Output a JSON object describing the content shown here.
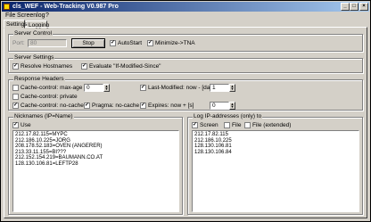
{
  "window": {
    "title": "cls_WEF - Web-Tracking V0.987 Pro",
    "min": "_",
    "max": "□",
    "close": "×"
  },
  "menu": [
    "File",
    "Screenlog",
    "?"
  ],
  "tabs": [
    "Settings",
    "Logging"
  ],
  "server_control": {
    "title": "Server Control",
    "port_label": "Port:",
    "port_value": "80",
    "stop_label": "Stop",
    "autostart_label": "AutoStart",
    "autostart_checked": true,
    "minimize_label": "Minimize->TNA",
    "minimize_checked": true
  },
  "server_settings": {
    "title": "Server Settings",
    "resolve_label": "Resolve Hostnames",
    "resolve_checked": true,
    "evaluate_label": "Evaluate \"If-Modified-Since\"",
    "evaluate_checked": true
  },
  "response_headers": {
    "title": "Response Headers",
    "maxage_label": "Cache-control: max-age [s]",
    "maxage_checked": false,
    "maxage_value": "0",
    "private_label": "Cache-control: private",
    "private_checked": false,
    "nocache_label": "Cache-control: no-cache",
    "nocache_checked": true,
    "pragma_label": "Pragma: no-cache",
    "pragma_checked": true,
    "lastmod_label": "Last-Modified: now - [days]",
    "lastmod_checked": true,
    "lastmod_value": "1",
    "expires_label": "Expires: now + [s]",
    "expires_checked": true,
    "expires_value": "0"
  },
  "nicknames": {
    "title": "Nicknames (IP=Name)",
    "use_label": "Use",
    "use_checked": true,
    "lines": [
      "212.17.82.115=MYPC",
      "212.186.10.225=JORG",
      "208.178.52.183=OVEN (ANGERER)",
      "213.33.11.155=BI???",
      "212.152.154.219=BAUMANN.CO.AT",
      "128.130.106.81=LEFTP28"
    ]
  },
  "log_ip": {
    "title": "Log IP-addresses (only) to",
    "screen_label": "Screen",
    "screen_checked": true,
    "file_label": "File",
    "file_checked": false,
    "file_ext_label": "File (extended)",
    "file_ext_checked": false,
    "lines": [
      "212.17.82.115",
      "212.186.10.225",
      "128.130.106.81",
      "128.130.106.84"
    ]
  }
}
